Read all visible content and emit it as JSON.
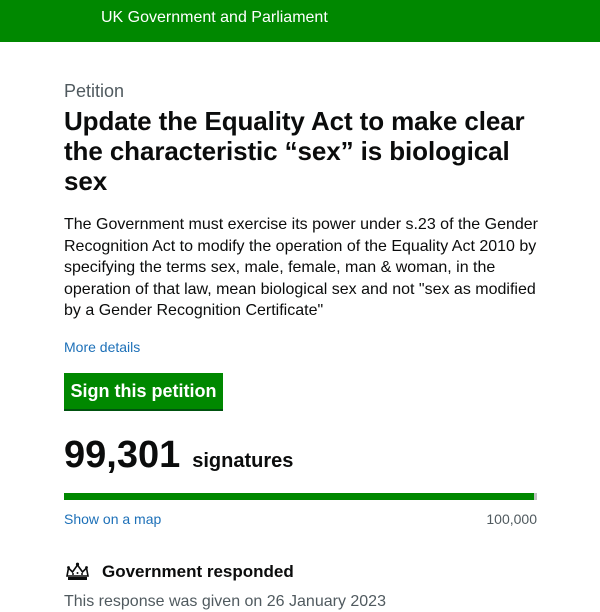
{
  "header": {
    "title": "UK Government and Parliament",
    "bg_color": "#008800"
  },
  "petition": {
    "caption": "Petition",
    "title": "Update the Equality Act to make clear the characteristic “sex” is biological sex",
    "summary": "The Government must exercise its power under s.23 of the Gender Recognition Act to modify the operation of the Equality Act 2010 by specifying the terms sex, male, female, man & woman, in the operation of that law, mean biological sex and not \"sex as modified by a Gender Recognition Certificate\"",
    "more_details_label": "More details",
    "sign_button_label": "Sign this petition"
  },
  "signatures": {
    "count": "99,301",
    "label": "signatures",
    "progress_fraction": 0.99301,
    "map_link_label": "Show on a map",
    "target": "100,000"
  },
  "response": {
    "icon": "crown-icon",
    "title": "Government responded",
    "date_text": "This response was given on 26 January 2023"
  }
}
